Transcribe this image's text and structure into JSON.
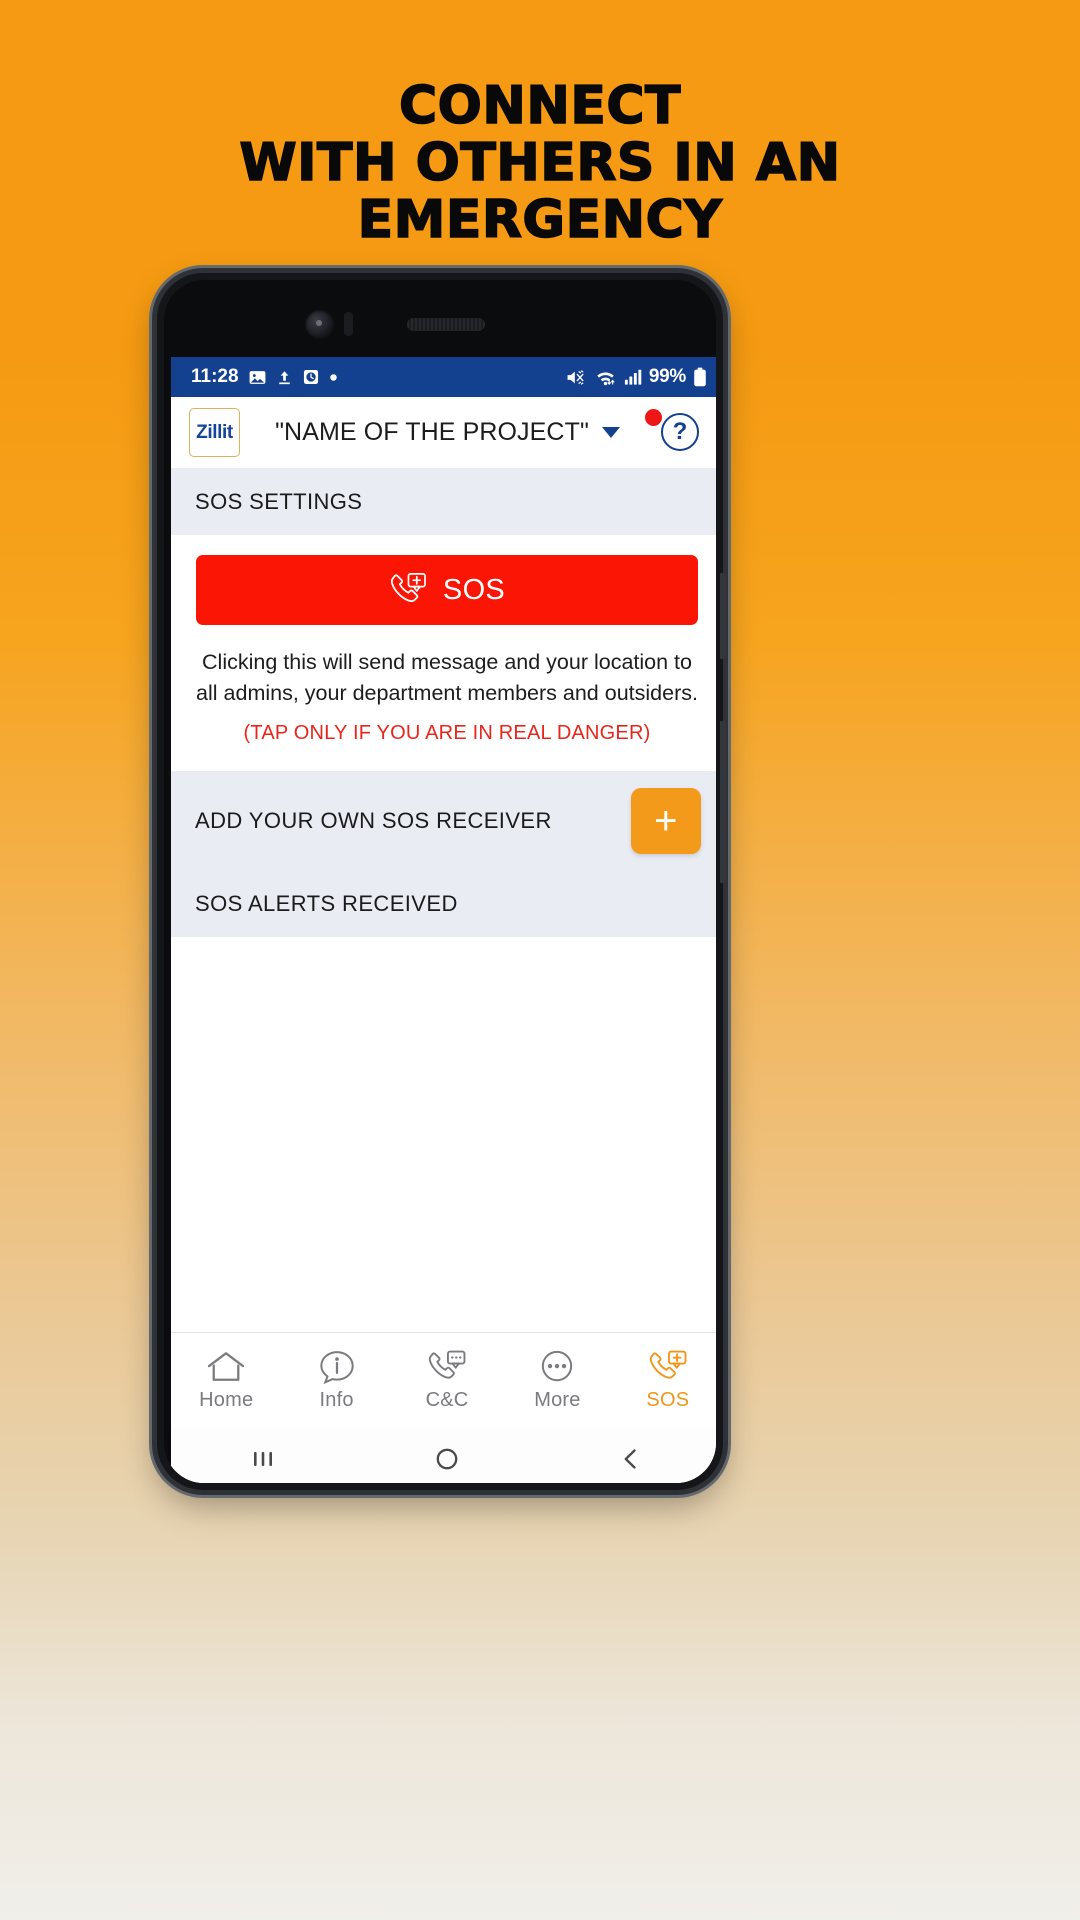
{
  "promo": {
    "headline_lines": [
      "CONNECT",
      "WITH OTHERS IN AN",
      "EMERGENCY"
    ],
    "background_top_color": "#F59A12",
    "background_bottom_color": "#F1EFEA"
  },
  "status_bar": {
    "time": "11:28",
    "left_icons": [
      "image-icon",
      "upload-icon",
      "alarm-clock-icon",
      "dot-icon"
    ],
    "right_icons": [
      "mute-icon",
      "wifi-icon",
      "signal-bars-icon"
    ],
    "battery_percent": "99%",
    "battery_icon": "battery-full-icon",
    "background_color": "#14418F"
  },
  "app_header": {
    "logo_text": "Zillit",
    "project_title": "\"NAME OF THE PROJECT\"",
    "dropdown_icon": "chevron-down-icon",
    "notification_badge": "",
    "help_icon_label": "?"
  },
  "sections": {
    "sos_settings_title": "SOS SETTINGS",
    "add_receiver_title": "ADD YOUR OWN SOS RECEIVER",
    "add_button_label": "+",
    "alerts_received_title": "SOS ALERTS RECEIVED"
  },
  "sos": {
    "button_label": "SOS",
    "button_icon": "emergency-call-icon",
    "button_color": "#FA1505",
    "description": "Clicking this will send message and your location to all admins, your department members and outsiders.",
    "warning": "(TAP ONLY IF YOU ARE IN REAL DANGER)",
    "warning_color": "#E8251B"
  },
  "bottom_nav": {
    "active_color": "#F0961A",
    "inactive_color": "#7B7B7F",
    "items": [
      {
        "label": "Home",
        "icon": "home-icon",
        "active": false
      },
      {
        "label": "Info",
        "icon": "info-bubble-icon",
        "active": false
      },
      {
        "label": "C&C",
        "icon": "call-chat-icon",
        "active": false
      },
      {
        "label": "More",
        "icon": "more-dots-icon",
        "active": false
      },
      {
        "label": "SOS",
        "icon": "emergency-call-icon",
        "active": true
      }
    ]
  },
  "android_nav": {
    "recents_icon": "recents-icon",
    "home_icon": "home-circle-icon",
    "back_icon": "back-chevron-icon"
  }
}
